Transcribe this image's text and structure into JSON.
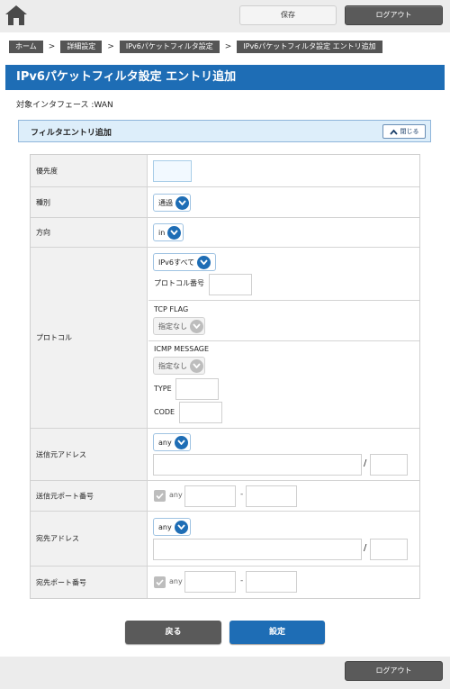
{
  "header": {
    "save_label": "保存",
    "logout_label": "ログアウト"
  },
  "breadcrumb": [
    "ホーム",
    "詳細設定",
    "IPv6パケットフィルタ設定",
    "IPv6パケットフィルタ設定 エントリ追加"
  ],
  "page_title": "IPv6パケットフィルタ設定 エントリ追加",
  "interface": "対象インタフェース :WAN",
  "section": {
    "title": "フィルタエントリ追加",
    "close_label": "閉じる"
  },
  "form": {
    "priority": {
      "label": "優先度",
      "value": ""
    },
    "type": {
      "label": "種別",
      "selected": "通過"
    },
    "direction": {
      "label": "方向",
      "selected": "in"
    },
    "protocol": {
      "label": "プロトコル",
      "selected": "IPv6すべて",
      "number_label": "プロトコル番号",
      "number_value": "",
      "tcp_flag_label": "TCP FLAG",
      "tcp_flag_selected": "指定なし",
      "icmp_label": "ICMP MESSAGE",
      "icmp_selected": "指定なし",
      "type_label": "TYPE",
      "type_value": "",
      "code_label": "CODE",
      "code_value": ""
    },
    "src_address": {
      "label": "送信元アドレス",
      "selected": "any",
      "address": "",
      "prefix": ""
    },
    "src_port": {
      "label": "送信元ポート番号",
      "any_label": "any",
      "any_checked": true,
      "from": "",
      "to": ""
    },
    "dst_address": {
      "label": "宛先アドレス",
      "selected": "any",
      "address": "",
      "prefix": ""
    },
    "dst_port": {
      "label": "宛先ポート番号",
      "any_label": "any",
      "any_checked": true,
      "from": "",
      "to": ""
    }
  },
  "buttons": {
    "back_label": "戻る",
    "set_label": "設定"
  },
  "footer": {
    "logout_label": "ログアウト"
  },
  "colors": {
    "accent": "#1e6db5",
    "dark_button": "#5a5a5a",
    "section_bg": "#ddeefa"
  }
}
